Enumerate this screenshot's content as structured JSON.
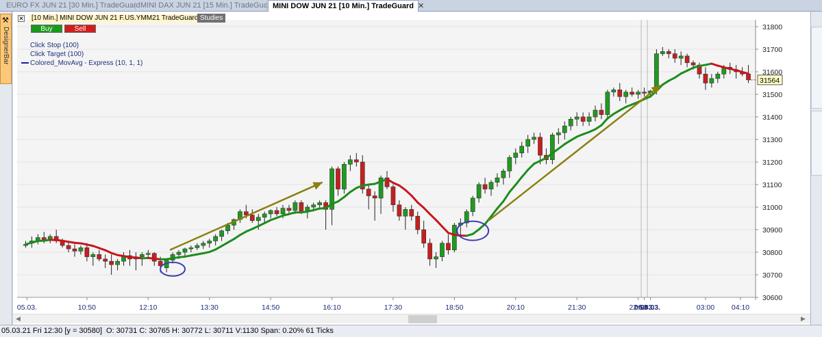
{
  "tabs": [
    {
      "label": "EURO FX JUN 21 [30 Min.]  TradeGuard",
      "active": false
    },
    {
      "label": "MINI DAX JUN 21 [15 Min.]  TradeGuard",
      "active": false
    },
    {
      "label": "MINI DOW JUN 21 [10 Min.]  TradeGuard",
      "active": true,
      "close": "✕"
    }
  ],
  "sidebar": {
    "designer_label": "DesignerBar",
    "designer_icon": "tools-icon"
  },
  "chart_header": {
    "title": "[10 Min.] MINI DOW JUN 21   F.US.YMM21 TradeGuard",
    "checkbox": "✕",
    "studies_label": "Studies",
    "buy_label": "Buy",
    "sell_label": "Sell"
  },
  "indicators": [
    {
      "label": "Click Stop  (100)"
    },
    {
      "label": "Click Target  (100)"
    },
    {
      "label": "Colored_MovAvg - Express  (10, 1, 1)"
    }
  ],
  "colors": {
    "up": "#1f9a1f",
    "down": "#c61f1f",
    "ma_up": "#1d8c1d",
    "ma_down": "#c8141e",
    "arrow": "#8a7f10",
    "circle": "#3c3cb4"
  },
  "last_price_badge": "31564",
  "status": {
    "left": "05.03.21 Fri  12:30 [y = 30580]",
    "right": "O: 30731 C: 30765 H: 30772 L: 30711 V:1130 Span: 0.20% 61 Ticks"
  },
  "chart_data": {
    "type": "candlestick",
    "title": "MINI DOW JUN 21 [10 Min.]",
    "ylim": [
      30600,
      31800
    ],
    "y_ticks": [
      "30600",
      "30700",
      "30800",
      "30900",
      "31000",
      "31100",
      "31200",
      "31300",
      "31400",
      "31500",
      "31600",
      "31700",
      "31800"
    ],
    "x_ticks": [
      "05.03.",
      "10:50",
      "12:10",
      "13:30",
      "14:50",
      "16:10",
      "17:30",
      "18:50",
      "20:10",
      "21:30",
      "22:50",
      "06.03.",
      "08.03.",
      "03:00",
      "04:10"
    ],
    "bold_x_ticks": [
      "06.03.",
      "08.03."
    ],
    "candles": [
      [
        30830,
        30850,
        30820,
        30835
      ],
      [
        30840,
        30870,
        30820,
        30850
      ],
      [
        30850,
        30880,
        30835,
        30865
      ],
      [
        30865,
        30890,
        30840,
        30855
      ],
      [
        30855,
        30880,
        30840,
        30870
      ],
      [
        30870,
        30900,
        30840,
        30850
      ],
      [
        30850,
        30860,
        30820,
        30830
      ],
      [
        30830,
        30850,
        30800,
        30815
      ],
      [
        30815,
        30835,
        30780,
        30805
      ],
      [
        30805,
        30830,
        30790,
        30820
      ],
      [
        30820,
        30840,
        30760,
        30780
      ],
      [
        30780,
        30800,
        30740,
        30790
      ],
      [
        30790,
        30810,
        30760,
        30770
      ],
      [
        30770,
        30790,
        30730,
        30760
      ],
      [
        30760,
        30790,
        30700,
        30745
      ],
      [
        30745,
        30770,
        30720,
        30760
      ],
      [
        30760,
        30800,
        30740,
        30785
      ],
      [
        30785,
        30810,
        30740,
        30770
      ],
      [
        30770,
        30800,
        30720,
        30780
      ],
      [
        30780,
        30800,
        30740,
        30790
      ],
      [
        30790,
        30810,
        30770,
        30795
      ],
      [
        30795,
        30800,
        30740,
        30760
      ],
      [
        30760,
        30780,
        30710,
        30740
      ],
      [
        30731,
        30772,
        30711,
        30765
      ],
      [
        30765,
        30800,
        30750,
        30790
      ],
      [
        30790,
        30810,
        30770,
        30800
      ],
      [
        30800,
        30820,
        30780,
        30815
      ],
      [
        30815,
        30830,
        30800,
        30820
      ],
      [
        30820,
        30840,
        30810,
        30830
      ],
      [
        30830,
        30850,
        30815,
        30840
      ],
      [
        30840,
        30860,
        30820,
        30850
      ],
      [
        30850,
        30880,
        30830,
        30870
      ],
      [
        30870,
        30900,
        30850,
        30895
      ],
      [
        30895,
        30930,
        30880,
        30920
      ],
      [
        30920,
        30950,
        30900,
        30945
      ],
      [
        30945,
        30990,
        30930,
        30980
      ],
      [
        30980,
        31010,
        30950,
        30965
      ],
      [
        30965,
        30990,
        30930,
        30940
      ],
      [
        30940,
        30970,
        30900,
        30955
      ],
      [
        30955,
        30980,
        30930,
        30970
      ],
      [
        30970,
        30990,
        30950,
        30985
      ],
      [
        30985,
        31000,
        30960,
        30970
      ],
      [
        30970,
        31010,
        30950,
        30995
      ],
      [
        30995,
        31010,
        30970,
        30985
      ],
      [
        30985,
        31030,
        30970,
        31020
      ],
      [
        31020,
        31030,
        30970,
        30980
      ],
      [
        30980,
        31010,
        30950,
        31000
      ],
      [
        31000,
        31020,
        30980,
        31010
      ],
      [
        31010,
        31030,
        30990,
        31020
      ],
      [
        31020,
        31030,
        30900,
        30990
      ],
      [
        30990,
        31180,
        30920,
        31170
      ],
      [
        31170,
        31180,
        31050,
        31080
      ],
      [
        31080,
        31200,
        31060,
        31190
      ],
      [
        31190,
        31230,
        31160,
        31210
      ],
      [
        31210,
        31240,
        31180,
        31200
      ],
      [
        31200,
        31230,
        31060,
        31080
      ],
      [
        31080,
        31100,
        30990,
        31050
      ],
      [
        31050,
        31070,
        30940,
        31040
      ],
      [
        31040,
        31140,
        30970,
        31130
      ],
      [
        31130,
        31160,
        31080,
        31090
      ],
      [
        31090,
        31100,
        30980,
        31010
      ],
      [
        31010,
        31030,
        30940,
        30960
      ],
      [
        30960,
        31000,
        30900,
        30990
      ],
      [
        30990,
        31010,
        30940,
        30960
      ],
      [
        30960,
        30980,
        30880,
        30900
      ],
      [
        30900,
        30940,
        30820,
        30840
      ],
      [
        30840,
        30860,
        30740,
        30770
      ],
      [
        30770,
        30800,
        30730,
        30780
      ],
      [
        30780,
        30850,
        30760,
        30840
      ],
      [
        30840,
        30880,
        30790,
        30810
      ],
      [
        30810,
        30930,
        30800,
        30920
      ],
      [
        30920,
        30950,
        30870,
        30930
      ],
      [
        30930,
        30990,
        30910,
        30980
      ],
      [
        30980,
        31050,
        30960,
        31040
      ],
      [
        31040,
        31110,
        31020,
        31100
      ],
      [
        31100,
        31130,
        31060,
        31080
      ],
      [
        31080,
        31120,
        31050,
        31110
      ],
      [
        31110,
        31150,
        31090,
        31130
      ],
      [
        31130,
        31170,
        31100,
        31160
      ],
      [
        31160,
        31230,
        31130,
        31220
      ],
      [
        31220,
        31260,
        31190,
        31240
      ],
      [
        31240,
        31290,
        31220,
        31270
      ],
      [
        31270,
        31320,
        31240,
        31300
      ],
      [
        31300,
        31330,
        31280,
        31310
      ],
      [
        31310,
        31330,
        31190,
        31230
      ],
      [
        31230,
        31260,
        31190,
        31210
      ],
      [
        31210,
        31330,
        31190,
        31320
      ],
      [
        31320,
        31350,
        31280,
        31330
      ],
      [
        31330,
        31380,
        31300,
        31360
      ],
      [
        31360,
        31400,
        31340,
        31390
      ],
      [
        31390,
        31420,
        31360,
        31400
      ],
      [
        31400,
        31420,
        31360,
        31380
      ],
      [
        31380,
        31420,
        31360,
        31400
      ],
      [
        31400,
        31450,
        31380,
        31430
      ],
      [
        31430,
        31460,
        31390,
        31410
      ],
      [
        31410,
        31520,
        31390,
        31510
      ],
      [
        31510,
        31530,
        31490,
        31520
      ],
      [
        31520,
        31550,
        31470,
        31490
      ],
      [
        31490,
        31520,
        31460,
        31510
      ],
      [
        31510,
        31530,
        31490,
        31500
      ],
      [
        31500,
        31520,
        31480,
        31510
      ],
      [
        31510,
        31530,
        31490,
        31505
      ],
      [
        31505,
        31520,
        31490,
        31515
      ],
      [
        31520,
        31700,
        31500,
        31680
      ],
      [
        31680,
        31710,
        31670,
        31690
      ],
      [
        31690,
        31700,
        31660,
        31680
      ],
      [
        31680,
        31700,
        31640,
        31660
      ],
      [
        31660,
        31690,
        31630,
        31670
      ],
      [
        31670,
        31680,
        31620,
        31640
      ],
      [
        31640,
        31650,
        31610,
        31630
      ],
      [
        31630,
        31640,
        31570,
        31590
      ],
      [
        31590,
        31620,
        31520,
        31550
      ],
      [
        31550,
        31590,
        31530,
        31570
      ],
      [
        31570,
        31600,
        31550,
        31590
      ],
      [
        31590,
        31630,
        31570,
        31620
      ],
      [
        31620,
        31640,
        31590,
        31610
      ],
      [
        31610,
        31630,
        31570,
        31600
      ],
      [
        31600,
        31620,
        31580,
        31590
      ],
      [
        31590,
        31630,
        31550,
        31564
      ]
    ],
    "moving_average_period": 10
  }
}
